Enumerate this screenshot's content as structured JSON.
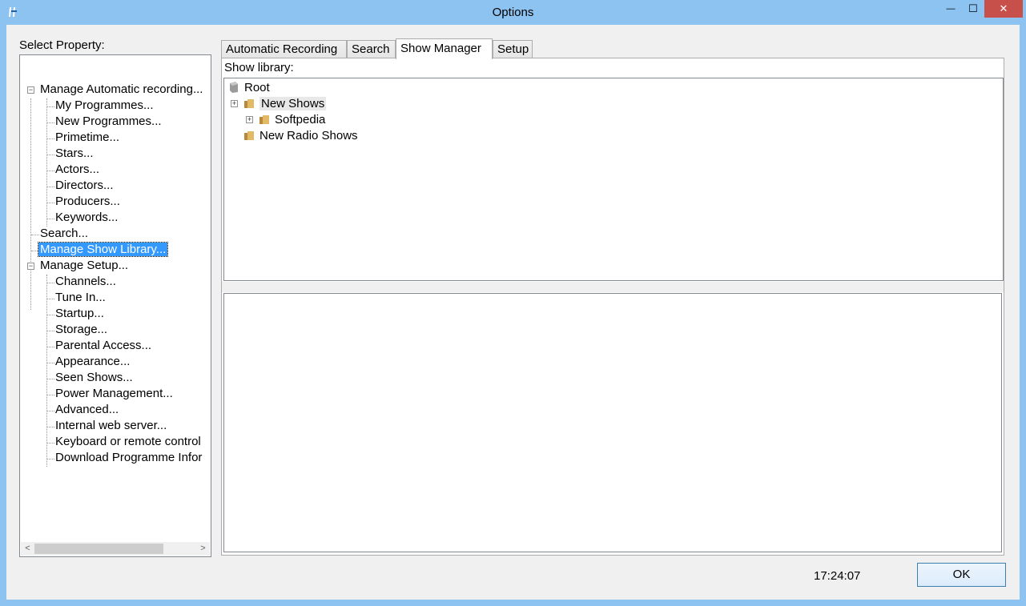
{
  "window": {
    "title": "Options",
    "close_glyph": "✕",
    "minimize_glyph": "—",
    "maximize_glyph": "☐"
  },
  "left": {
    "label": "Select Property:",
    "tree": {
      "group1": {
        "label": "Manage Automatic recording...",
        "expander": "−",
        "children": [
          "My Programmes...",
          "New Programmes...",
          "Primetime...",
          "Stars...",
          "Actors...",
          "Directors...",
          "Producers...",
          "Keywords..."
        ]
      },
      "search": "Search...",
      "show_library": "Manage Show Library...",
      "group2": {
        "label": "Manage Setup...",
        "expander": "−",
        "children": [
          "Channels...",
          "Tune In...",
          "Startup...",
          "Storage...",
          "Parental Access...",
          "Appearance...",
          "Seen Shows...",
          "Power Management...",
          "Advanced...",
          "Internal web server...",
          "Keyboard or remote control",
          "Download Programme Infor"
        ]
      }
    },
    "scroll_left": "<",
    "scroll_right": ">"
  },
  "tabs": [
    "Automatic Recording",
    "Search",
    "Show Manager",
    "Setup"
  ],
  "active_tab": "Show Manager",
  "panel": {
    "label": "Show library:",
    "library": {
      "root": "Root",
      "new_shows": "New Shows",
      "softpedia": "Softpedia",
      "new_radio_shows": "New Radio Shows",
      "expander": "+"
    }
  },
  "status": {
    "time": "17:24:07"
  },
  "ok_label": "OK",
  "colors": {
    "titlebar": "#8cc3f0",
    "selection": "#3399ff",
    "close_button": "#c7504b"
  }
}
